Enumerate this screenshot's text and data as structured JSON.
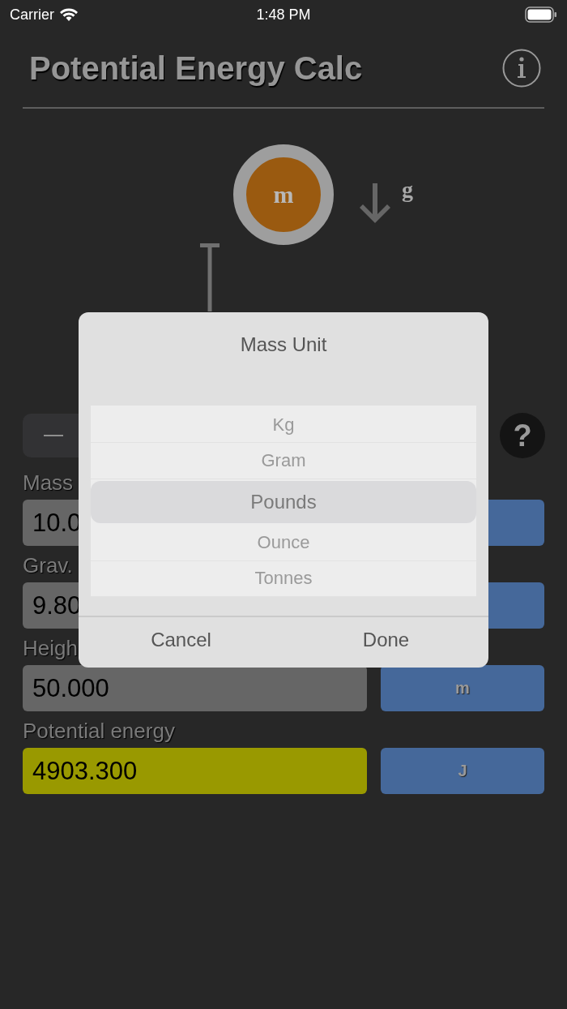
{
  "status_bar": {
    "carrier": "Carrier",
    "time": "1:48 PM"
  },
  "header": {
    "title": "Potential Energy Calc"
  },
  "diagram": {
    "mass_label": "m",
    "gravity_label": "g"
  },
  "toolbar": {
    "help": "?"
  },
  "fields": [
    {
      "label": "Mass",
      "value": "10.0",
      "kind": "input"
    },
    {
      "label": "Grav.",
      "value": "9.80",
      "kind": "input"
    },
    {
      "label": "Heigh",
      "value": "50.000",
      "unit": "m",
      "kind": "input"
    },
    {
      "label": "Potential energy",
      "value": "4903.300",
      "unit": "J",
      "kind": "result"
    }
  ],
  "picker": {
    "title": "Mass Unit",
    "options": [
      {
        "label": "Kg",
        "selected": false
      },
      {
        "label": "Gram",
        "selected": false
      },
      {
        "label": "Pounds",
        "selected": true
      },
      {
        "label": "Ounce",
        "selected": false
      },
      {
        "label": "Tonnes",
        "selected": false
      }
    ],
    "buttons": [
      "Cancel",
      "Done"
    ]
  }
}
